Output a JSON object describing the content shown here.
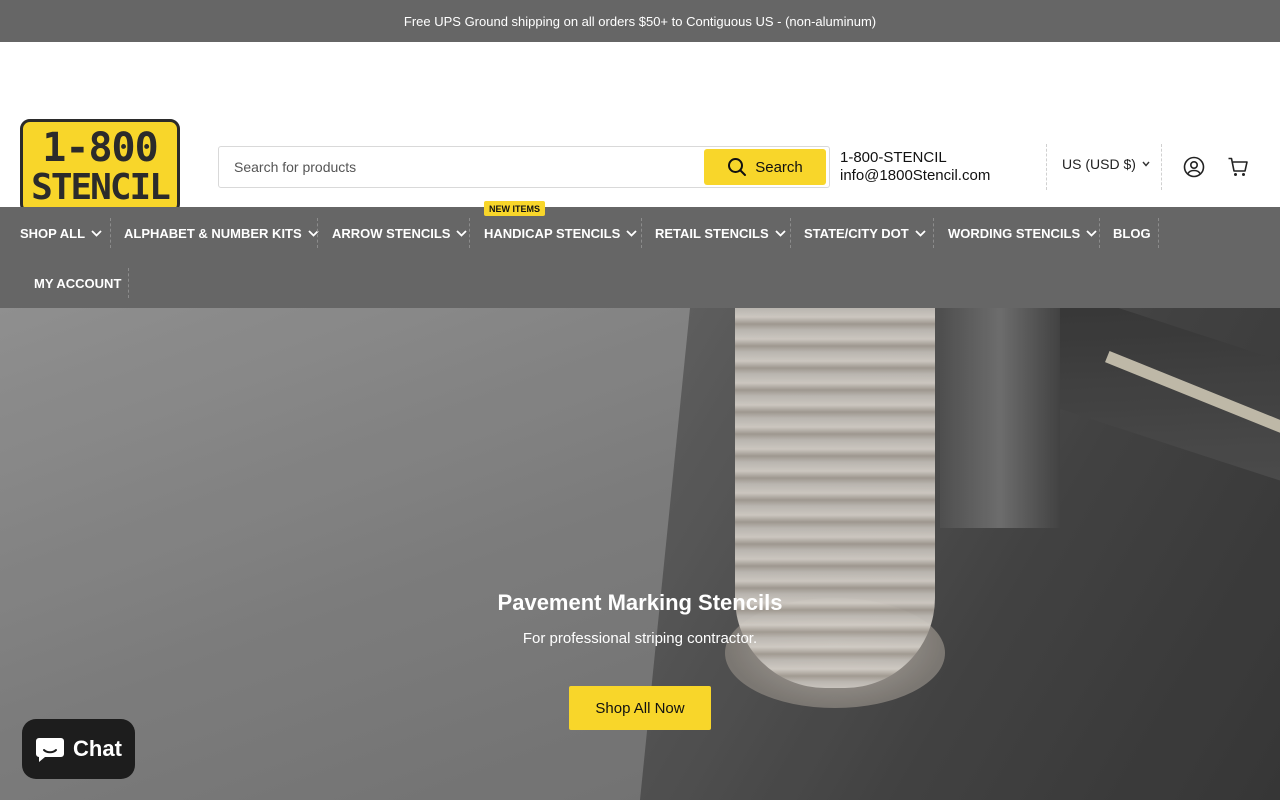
{
  "announcement": "Free UPS Ground shipping on all orders $50+ to Contiguous US - (non-aluminum)",
  "logo": {
    "line1": "1-800",
    "line2": "STENCIL"
  },
  "search": {
    "placeholder": "Search for products",
    "button_label": "Search"
  },
  "contact": {
    "phone": "1-800-STENCIL",
    "email": "info@1800Stencil.com"
  },
  "currency": "US (USD $)",
  "nav": {
    "badge": "NEW ITEMS",
    "items": [
      {
        "label": "SHOP ALL"
      },
      {
        "label": "ALPHABET & NUMBER KITS"
      },
      {
        "label": "ARROW STENCILS"
      },
      {
        "label": "HANDICAP STENCILS"
      },
      {
        "label": "RETAIL STENCILS"
      },
      {
        "label": "STATE/CITY DOT"
      },
      {
        "label": "WORDING STENCILS"
      },
      {
        "label": "BLOG"
      },
      {
        "label": "MY ACCOUNT"
      }
    ]
  },
  "hero": {
    "title": "Pavement Marking Stencils",
    "subtitle": "For professional striping contractor.",
    "button_label": "Shop All Now"
  },
  "chat": {
    "label": "Chat"
  },
  "colors": {
    "accent": "#f8d62a",
    "nav_bg": "#666666",
    "dark": "#1d1d1d"
  }
}
